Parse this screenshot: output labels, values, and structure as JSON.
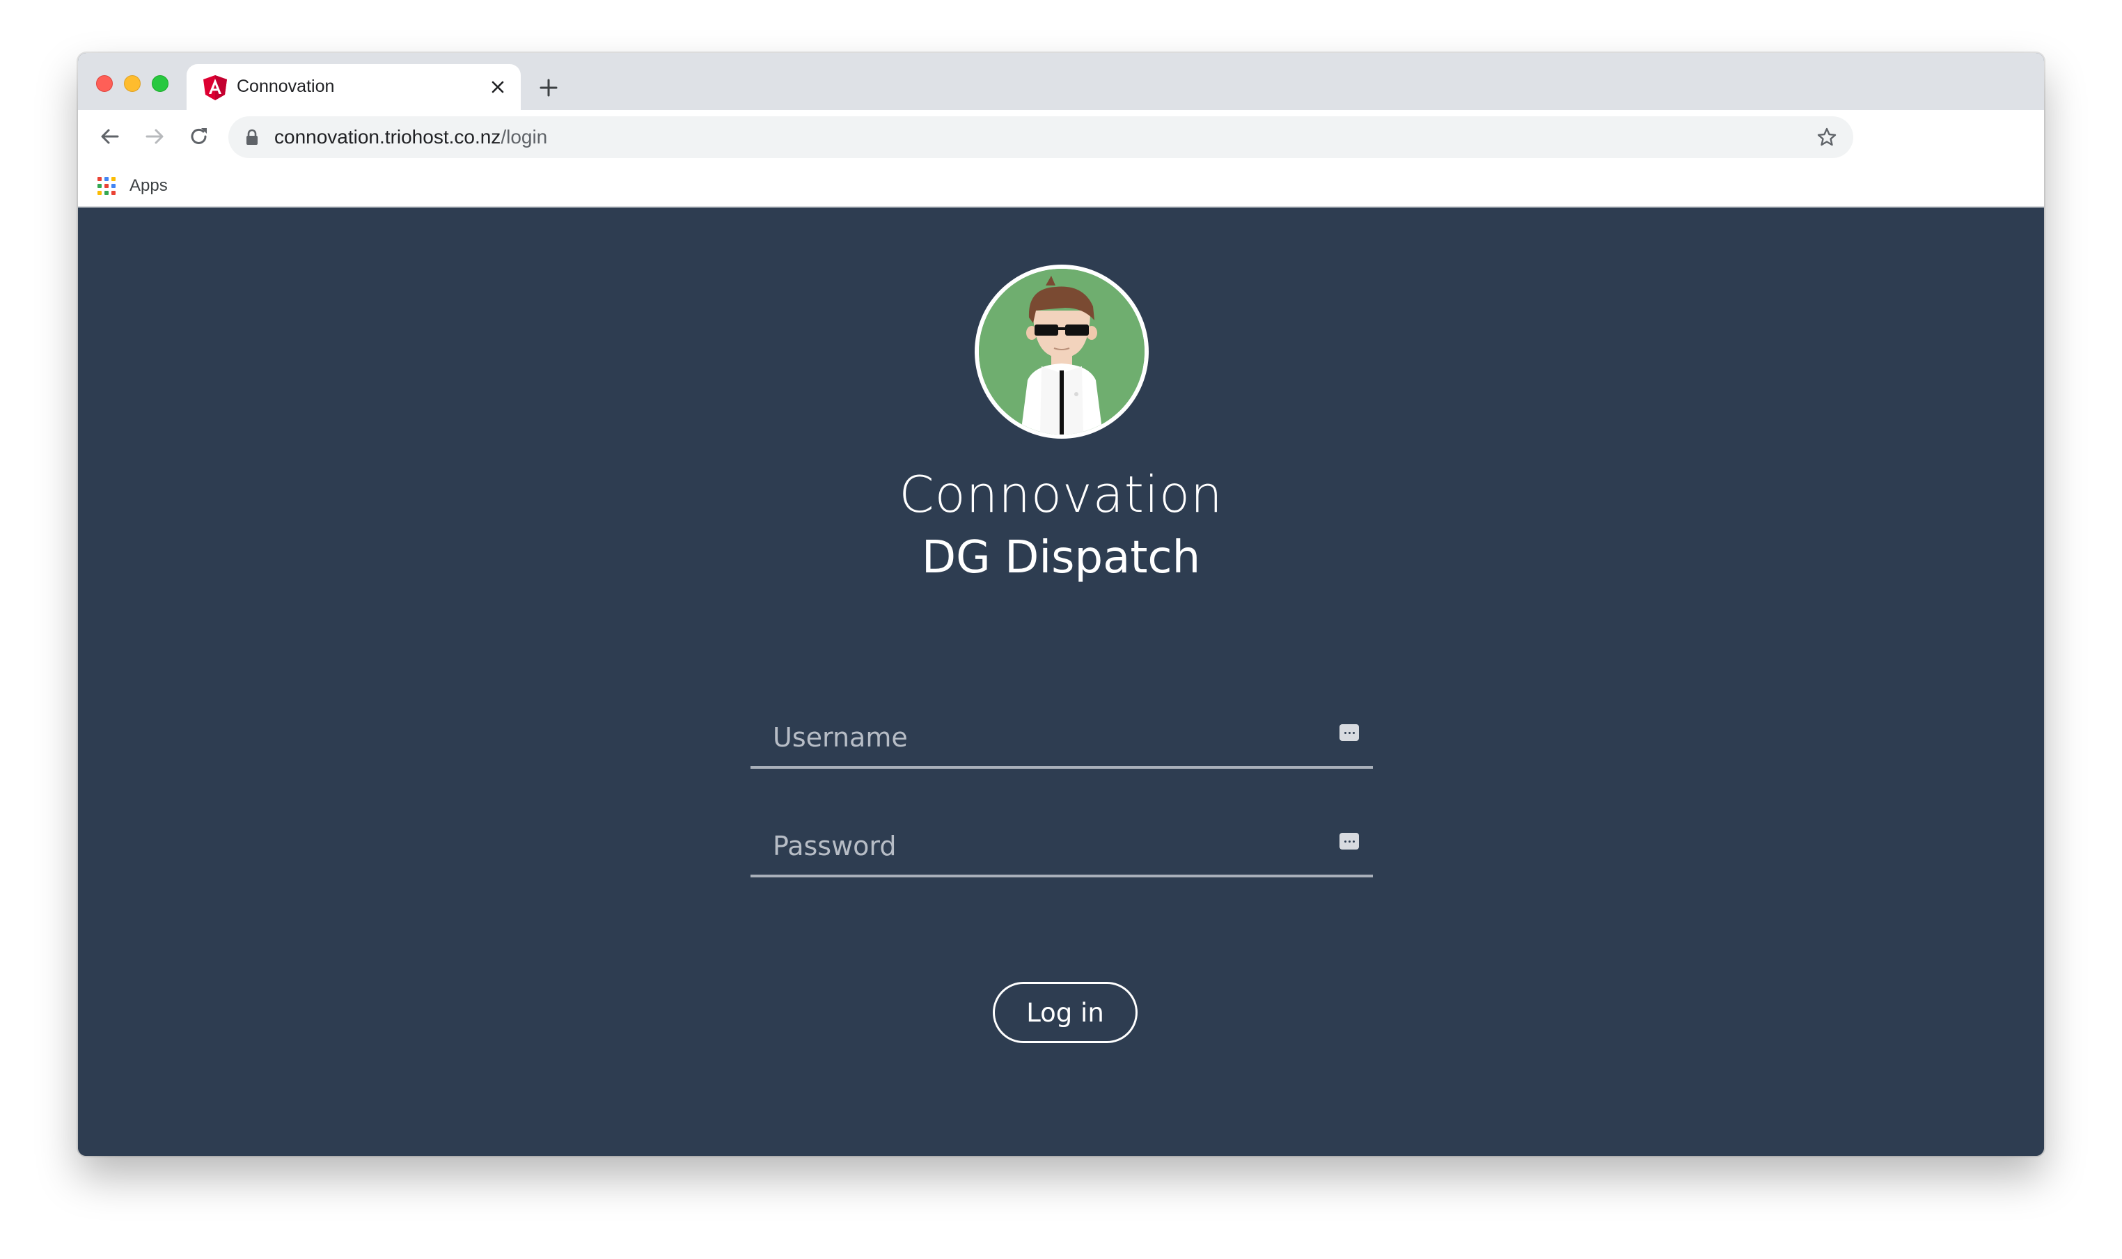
{
  "browser": {
    "tab": {
      "title": "Connovation"
    },
    "address_bar": {
      "domain": "connovation.triohost.co.nz",
      "path": "/login"
    },
    "bookmarks": {
      "apps_label": "Apps"
    }
  },
  "page": {
    "title": "Connovation",
    "subtitle": "DG Dispatch",
    "username": {
      "placeholder": "Username",
      "value": ""
    },
    "password": {
      "placeholder": "Password",
      "value": ""
    },
    "login_label": "Log in"
  },
  "colors": {
    "page_background": "#2e3d51",
    "avatar_background": "#6fae6f",
    "field_underline": "#a9b0ba"
  }
}
